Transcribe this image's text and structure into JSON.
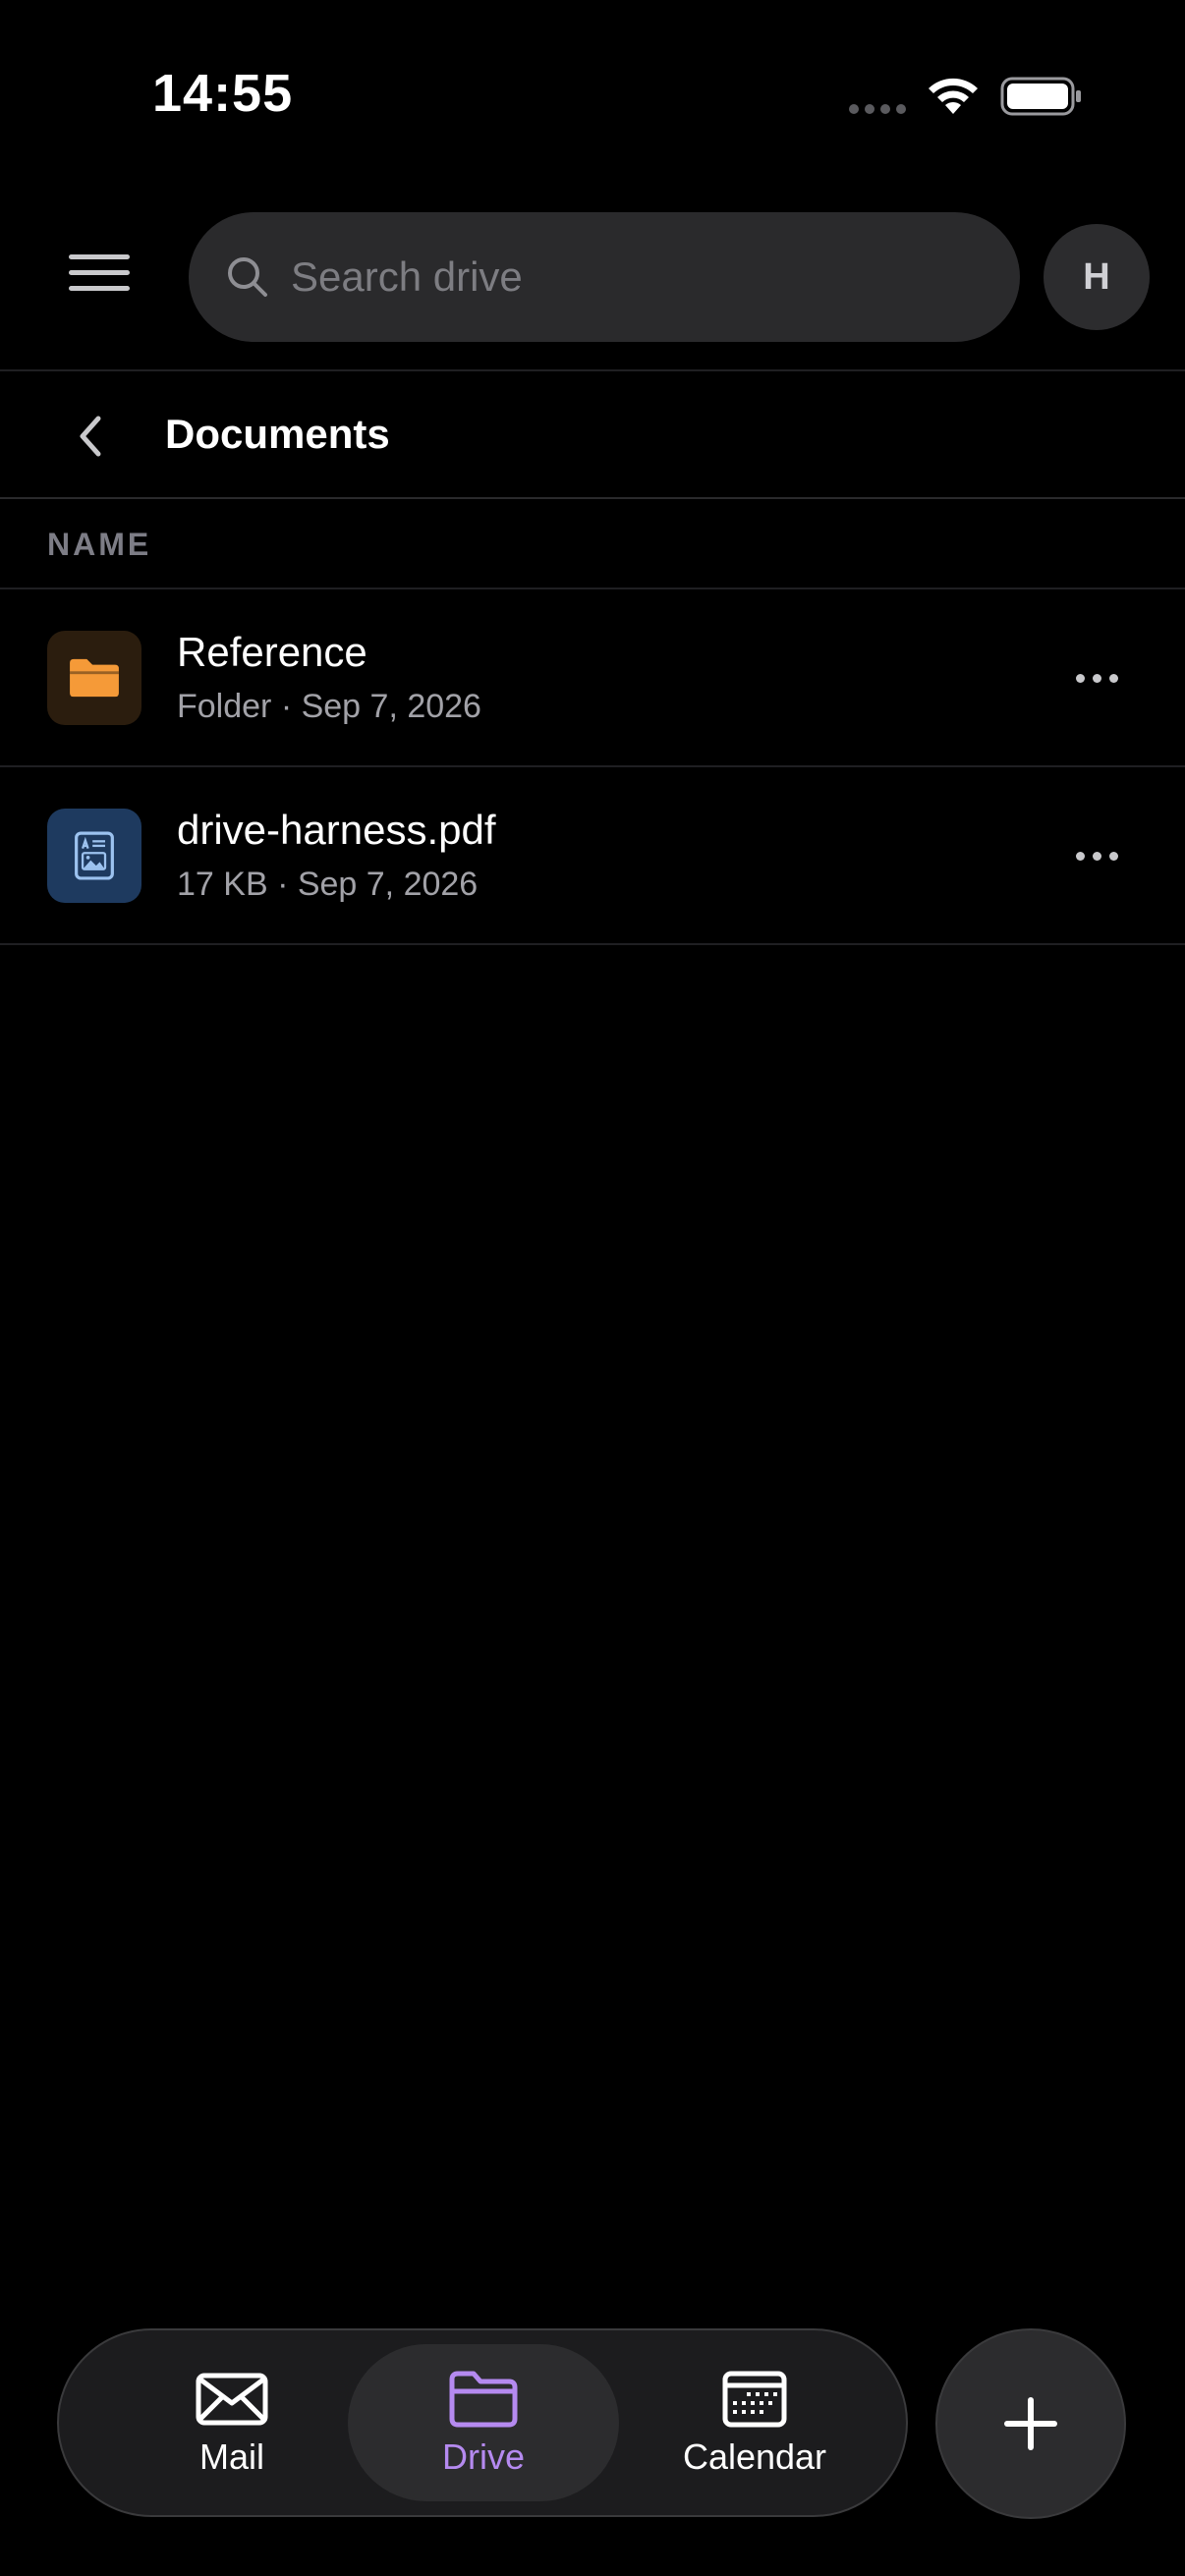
{
  "status_bar": {
    "time": "14:55"
  },
  "header": {
    "search_placeholder": "Search drive",
    "avatar_initial": "H"
  },
  "breadcrumb": {
    "title": "Documents"
  },
  "list": {
    "column_header": "NAME",
    "items": [
      {
        "name": "Reference",
        "meta": "Folder · Sep 7, 2026",
        "icon": "folder-icon",
        "color": "#f59a38"
      },
      {
        "name": "drive-harness.pdf",
        "meta": "17 KB · Sep 7, 2026",
        "icon": "pdf-document-icon",
        "color": "#9cc2ef"
      }
    ]
  },
  "bottom_nav": {
    "items": [
      {
        "label": "Mail",
        "icon": "mail-icon",
        "active": false
      },
      {
        "label": "Drive",
        "icon": "folder-icon",
        "active": true
      },
      {
        "label": "Calendar",
        "icon": "calendar-icon",
        "active": false
      }
    ],
    "active_color": "#b58af0",
    "fab_icon": "plus-icon"
  }
}
